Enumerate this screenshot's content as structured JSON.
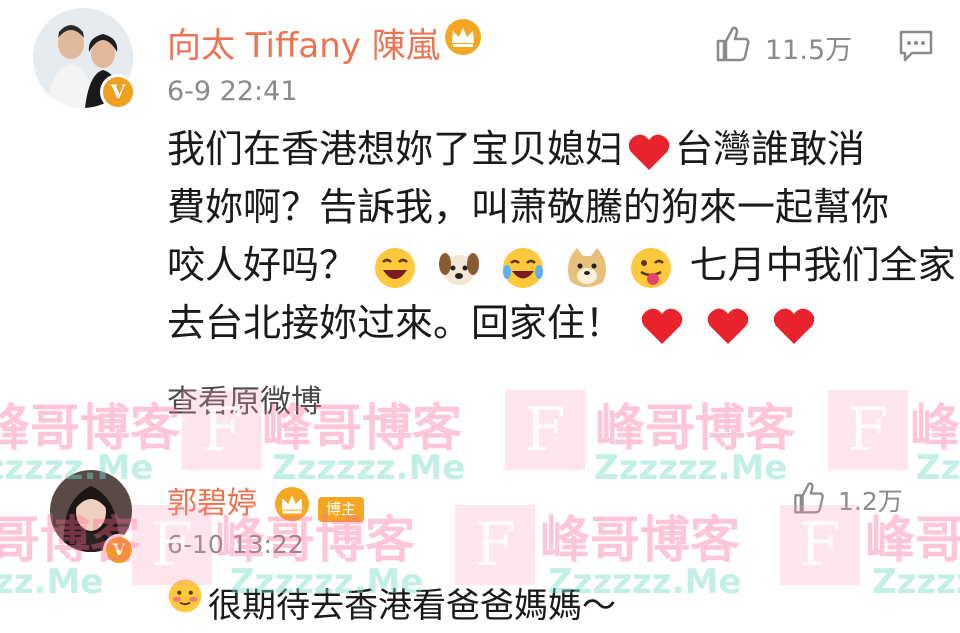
{
  "post": {
    "username": "向太 Tiffany 陳嵐",
    "timestamp": "6-9 22:41",
    "likes": "11.5万",
    "lines": [
      "我们在香港想妳了宝贝媳妇",
      "台灣誰敢消",
      "費妳啊？告訴我，叫萧敬騰的狗來一起幫你",
      "咬人好吗？",
      "七月中我们全家",
      "去台北接妳过來。回家住！"
    ],
    "view_original": "查看原微博"
  },
  "reply": {
    "username": "郭碧婷",
    "author_tag": "博主",
    "timestamp": "6-10 13:22",
    "likes": "1.2万",
    "text": "很期待去香港看爸爸媽媽～"
  },
  "watermark": {
    "brand": "峰哥博客",
    "url": "Zzzzzz.Me",
    "logo": "F"
  },
  "icons": {
    "crown": "crown-icon",
    "like": "thumbs-up-icon",
    "comment": "comment-icon",
    "verified": "verified-v-icon"
  },
  "colors": {
    "username": "#eb7350",
    "meta": "#8a8a8a",
    "heart": "#e8232d",
    "crown": "#f5a623",
    "watermark": "#ff6996"
  }
}
